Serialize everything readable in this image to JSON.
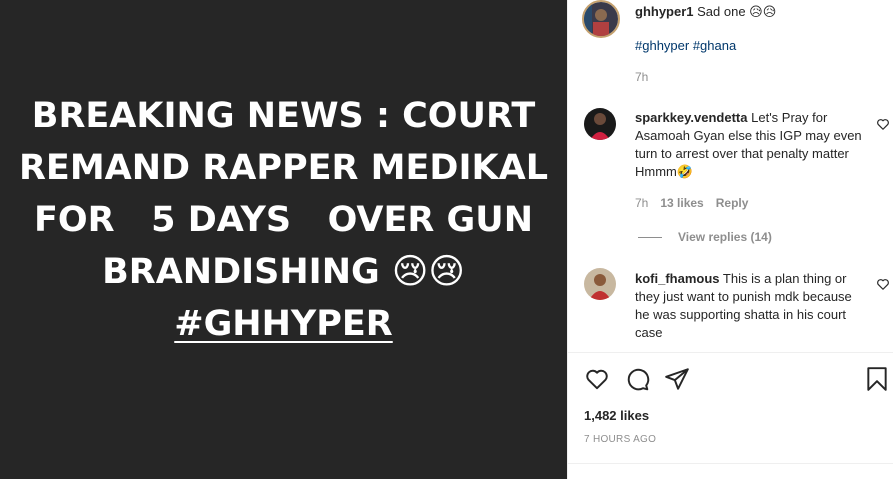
{
  "post": {
    "headline_lines": [
      "BREAKING NEWS : COURT",
      "REMAND RAPPER MEDIKAL",
      "FOR   5 DAYS   OVER GUN",
      "BRANDISHING 😢😢"
    ],
    "headline_tag": "#GHHYPER",
    "background_color": "#262626"
  },
  "caption": {
    "username": "ghhyper1",
    "text": "Sad one 😥😥",
    "hashtags": "#ghhyper #ghana",
    "time": "7h"
  },
  "comments": [
    {
      "username": "sparkkey.vendetta",
      "text": "Let's Pray for Asamoah Gyan else this IGP may even turn to arrest over that penalty matter Hmmm🤣",
      "time": "7h",
      "likes": "13 likes",
      "reply": "Reply",
      "view_replies": "View replies (14)"
    },
    {
      "username": "kofi_fhamous",
      "text": "This is a plan thing or they just want to punish mdk because he was supporting shatta in his court case"
    }
  ],
  "actions": {
    "icons": [
      "heart-icon",
      "comment-icon",
      "share-icon",
      "bookmark-icon"
    ]
  },
  "likes_count": "1,482 likes",
  "post_time": "7 HOURS AGO"
}
